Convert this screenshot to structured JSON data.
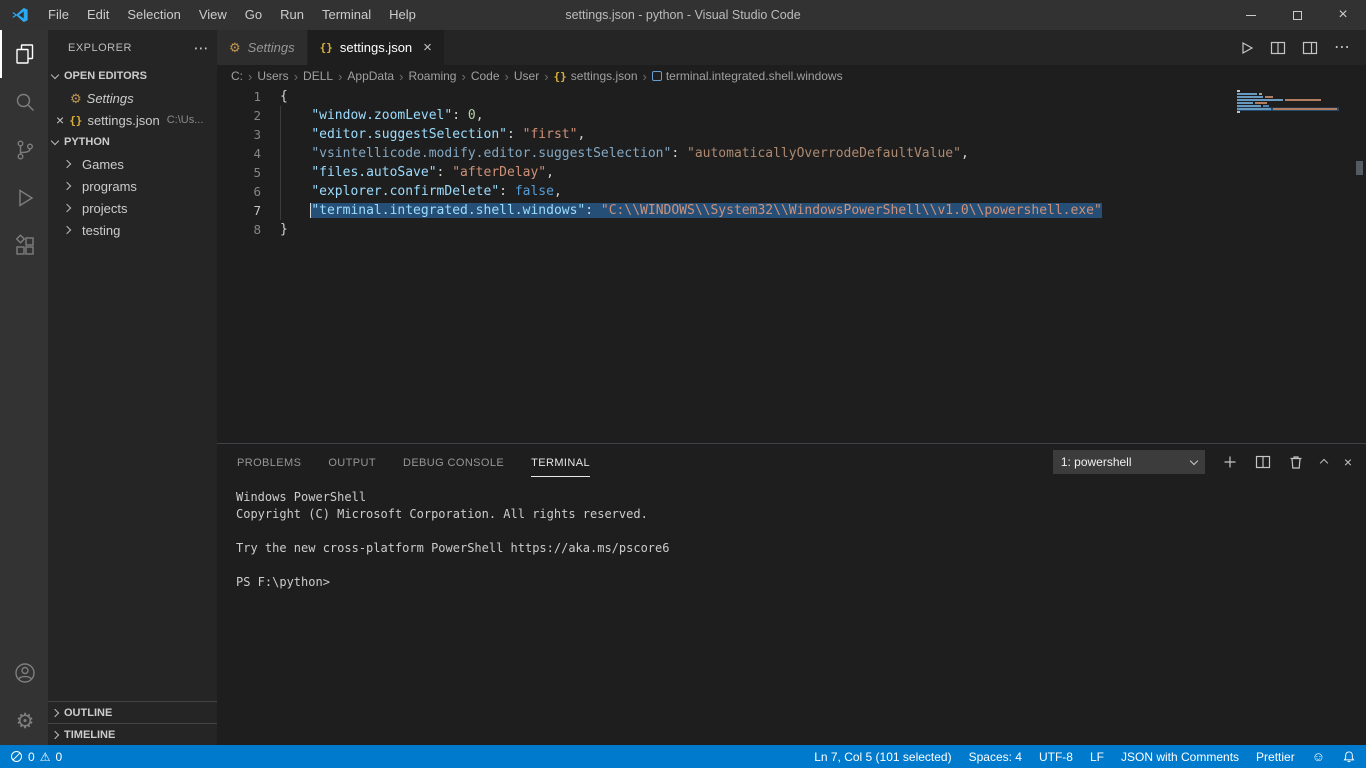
{
  "icons": {
    "json_glyph": "{}",
    "gear_glyph": "⚙",
    "ellipsis_glyph": "⋯",
    "close_glyph": "×",
    "breadcrumb_separator": "›",
    "warning_glyph": "⚠",
    "plus_glyph": "+",
    "feedback_glyph": "☺"
  },
  "colors": {
    "accent": "#007acc",
    "selection": "#264f78",
    "status_bar": "#007acc"
  },
  "title_bar": {
    "menus": [
      "File",
      "Edit",
      "Selection",
      "View",
      "Go",
      "Run",
      "Terminal",
      "Help"
    ],
    "title": "settings.json - python - Visual Studio Code"
  },
  "sidebar": {
    "header": "EXPLORER",
    "sections": {
      "open_editors": {
        "label": "OPEN EDITORS",
        "items": [
          {
            "label": "Settings"
          },
          {
            "label": "settings.json",
            "detail": "C:\\Us..."
          }
        ]
      },
      "workspace": {
        "label": "PYTHON",
        "folders": [
          "Games",
          "programs",
          "projects",
          "testing"
        ]
      },
      "outline": {
        "label": "OUTLINE"
      },
      "timeline": {
        "label": "TIMELINE"
      }
    }
  },
  "editor": {
    "tabs": [
      {
        "label": "Settings"
      },
      {
        "label": "settings.json"
      }
    ],
    "breadcrumbs": [
      "C:",
      "Users",
      "DELL",
      "AppData",
      "Roaming",
      "Code",
      "User",
      "settings.json",
      "terminal.integrated.shell.windows"
    ],
    "code_lines": [
      {
        "num": "1",
        "tokens": [
          {
            "t": "{",
            "c": "punct"
          }
        ]
      },
      {
        "num": "2",
        "tokens": [
          {
            "t": "    ",
            "c": "punct"
          },
          {
            "t": "\"window.zoomLevel\"",
            "c": "key"
          },
          {
            "t": ": ",
            "c": "punct"
          },
          {
            "t": "0",
            "c": "num"
          },
          {
            "t": ",",
            "c": "punct"
          }
        ]
      },
      {
        "num": "3",
        "tokens": [
          {
            "t": "    ",
            "c": "punct"
          },
          {
            "t": "\"editor.suggestSelection\"",
            "c": "key"
          },
          {
            "t": ": ",
            "c": "punct"
          },
          {
            "t": "\"first\"",
            "c": "str"
          },
          {
            "t": ",",
            "c": "punct"
          }
        ]
      },
      {
        "num": "4",
        "tokens": [
          {
            "t": "    ",
            "c": "punct"
          },
          {
            "t": "\"vsintellicode.modify.editor.suggestSelection\"",
            "c": "key-dim"
          },
          {
            "t": ": ",
            "c": "punct"
          },
          {
            "t": "\"automaticallyOverrodeDefaultValue\"",
            "c": "str-dim"
          },
          {
            "t": ",",
            "c": "punct"
          }
        ]
      },
      {
        "num": "5",
        "tokens": [
          {
            "t": "    ",
            "c": "punct"
          },
          {
            "t": "\"files.autoSave\"",
            "c": "key"
          },
          {
            "t": ": ",
            "c": "punct"
          },
          {
            "t": "\"afterDelay\"",
            "c": "str"
          },
          {
            "t": ",",
            "c": "punct"
          }
        ]
      },
      {
        "num": "6",
        "tokens": [
          {
            "t": "    ",
            "c": "punct"
          },
          {
            "t": "\"explorer.confirmDelete\"",
            "c": "key"
          },
          {
            "t": ": ",
            "c": "punct"
          },
          {
            "t": "false",
            "c": "kw"
          },
          {
            "t": ",",
            "c": "punct"
          }
        ]
      },
      {
        "num": "7",
        "active": true,
        "tokens": [
          {
            "t": "    ",
            "c": "punct"
          },
          {
            "t": "\"terminal.integrated.shell.windows\"",
            "c": "key",
            "sel": true,
            "cursor": true
          },
          {
            "t": ": ",
            "c": "punct",
            "sel": true
          },
          {
            "t": "\"C:\\\\WINDOWS\\\\System32\\\\WindowsPowerShell\\\\v1.0\\\\powershell.exe\"",
            "c": "str",
            "sel": true
          }
        ]
      },
      {
        "num": "8",
        "tokens": [
          {
            "t": "}",
            "c": "punct"
          }
        ]
      }
    ]
  },
  "panel": {
    "tabs": [
      {
        "label": "PROBLEMS"
      },
      {
        "label": "OUTPUT"
      },
      {
        "label": "DEBUG CONSOLE"
      },
      {
        "label": "TERMINAL"
      }
    ],
    "terminal_picker": "1: powershell",
    "terminal_lines": [
      "Windows PowerShell",
      "Copyright (C) Microsoft Corporation. All rights reserved.",
      "",
      "Try the new cross-platform PowerShell https://aka.ms/pscore6",
      "",
      "PS F:\\python>"
    ]
  },
  "status_bar": {
    "errors": "0",
    "warnings": "0",
    "cursor_position": "Ln 7, Col 5 (101 selected)",
    "indentation": "Spaces: 4",
    "encoding": "UTF-8",
    "eol": "LF",
    "language": "JSON with Comments",
    "formatter": "Prettier"
  }
}
